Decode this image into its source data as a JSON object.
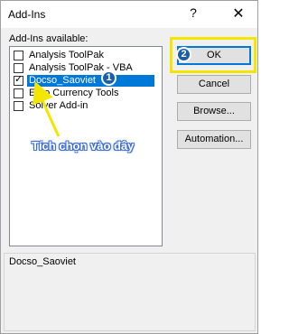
{
  "dialog": {
    "title": "Add-Ins",
    "help_glyph": "?",
    "close_glyph": "✕"
  },
  "list": {
    "label": "Add-Ins available:",
    "items": [
      {
        "label": "Analysis ToolPak",
        "checked": false
      },
      {
        "label": "Analysis ToolPak - VBA",
        "checked": false
      },
      {
        "label": "Docso_Saoviet",
        "checked": true
      },
      {
        "label": "Euro Currency Tools",
        "checked": false
      },
      {
        "label": "Solver Add-in",
        "checked": false
      }
    ]
  },
  "buttons": {
    "ok": "OK",
    "cancel": "Cancel",
    "browse": "Browse...",
    "automation": "Automation..."
  },
  "annotations": {
    "step1": "1",
    "step2": "2",
    "note": "Tích chọn vào đây",
    "highlight_color": "#f3e600",
    "callout_color": "#1a5ea8"
  },
  "description": {
    "group_label": "Docso_Saoviet"
  }
}
